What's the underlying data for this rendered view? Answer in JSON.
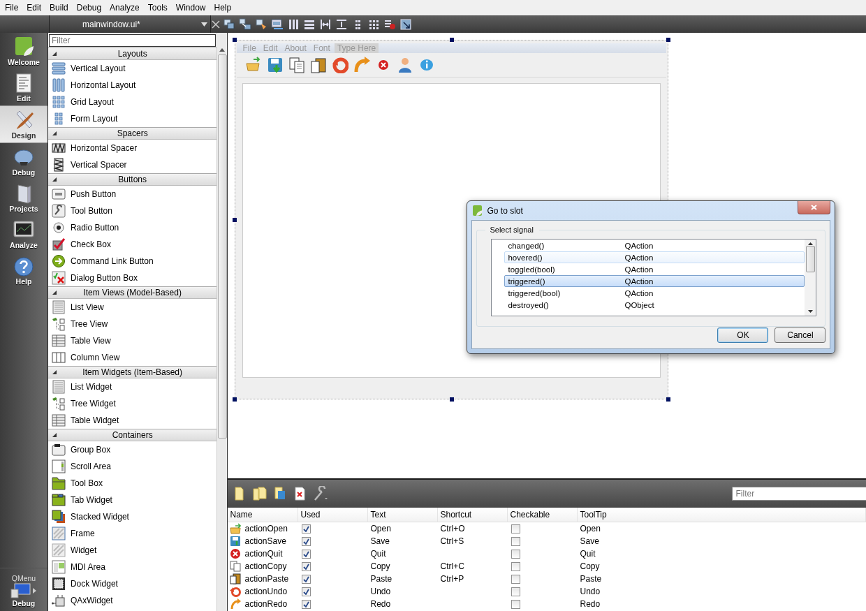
{
  "menubar": [
    "File",
    "Edit",
    "Build",
    "Debug",
    "Analyze",
    "Tools",
    "Window",
    "Help"
  ],
  "document": {
    "name": "mainwindow.ui*"
  },
  "mode_bar": {
    "items": [
      {
        "label": "Welcome",
        "selected": false
      },
      {
        "label": "Edit",
        "selected": false
      },
      {
        "label": "Design",
        "selected": true
      },
      {
        "label": "Debug",
        "selected": false
      },
      {
        "label": "Projects",
        "selected": false
      },
      {
        "label": "Analyze",
        "selected": false
      },
      {
        "label": "Help",
        "selected": false
      }
    ],
    "target_label": "QMenu",
    "target_mode": "Debug"
  },
  "widget_box": {
    "filter_placeholder": "Filter",
    "categories": [
      {
        "title": "Layouts",
        "items": [
          "Vertical Layout",
          "Horizontal Layout",
          "Grid Layout",
          "Form Layout"
        ]
      },
      {
        "title": "Spacers",
        "items": [
          "Horizontal Spacer",
          "Vertical Spacer"
        ]
      },
      {
        "title": "Buttons",
        "items": [
          "Push Button",
          "Tool Button",
          "Radio Button",
          "Check Box",
          "Command Link Button",
          "Dialog Button Box"
        ]
      },
      {
        "title": "Item Views (Model-Based)",
        "items": [
          "List View",
          "Tree View",
          "Table View",
          "Column View"
        ]
      },
      {
        "title": "Item Widgets (Item-Based)",
        "items": [
          "List Widget",
          "Tree Widget",
          "Table Widget"
        ]
      },
      {
        "title": "Containers",
        "items": [
          "Group Box",
          "Scroll Area",
          "Tool Box",
          "Tab Widget",
          "Stacked Widget",
          "Frame",
          "Widget",
          "MDI Area",
          "Dock Widget",
          "QAxWidget"
        ]
      }
    ]
  },
  "form": {
    "menu": [
      {
        "label": "File",
        "kind": "menu"
      },
      {
        "label": "Edit",
        "kind": "menu"
      },
      {
        "label": "About",
        "kind": "menu"
      },
      {
        "label": "Font",
        "kind": "menu"
      },
      {
        "label": "Type Here",
        "kind": "placeholder"
      }
    ]
  },
  "dialog": {
    "title": "Go to slot",
    "group_title": "Select signal",
    "signals": [
      {
        "name": "changed()",
        "class": "QAction",
        "hovered": false,
        "selected": false
      },
      {
        "name": "hovered()",
        "class": "QAction",
        "hovered": true,
        "selected": false
      },
      {
        "name": "toggled(bool)",
        "class": "QAction",
        "hovered": false,
        "selected": false
      },
      {
        "name": "triggered()",
        "class": "QAction",
        "hovered": false,
        "selected": true
      },
      {
        "name": "triggered(bool)",
        "class": "QAction",
        "hovered": false,
        "selected": false
      },
      {
        "name": "destroyed()",
        "class": "QObject",
        "hovered": false,
        "selected": false
      }
    ],
    "buttons": [
      "OK",
      "Cancel"
    ]
  },
  "action_editor": {
    "filter_placeholder": "Filter",
    "columns": [
      "Name",
      "Used",
      "Text",
      "Shortcut",
      "Checkable",
      "ToolTip"
    ],
    "actions": [
      {
        "name": "actionOpen",
        "used": true,
        "text": "Open",
        "shortcut": "Ctrl+O",
        "checkable": false,
        "tooltip": "Open"
      },
      {
        "name": "actionSave",
        "used": true,
        "text": "Save",
        "shortcut": "Ctrl+S",
        "checkable": false,
        "tooltip": "Save"
      },
      {
        "name": "actionQuit",
        "used": true,
        "text": "Quit",
        "checkable": false,
        "tooltip": "Quit"
      },
      {
        "name": "actionCopy",
        "used": true,
        "text": "Copy",
        "shortcut": "Ctrl+C",
        "checkable": false,
        "tooltip": "Copy"
      },
      {
        "name": "actionPaste",
        "used": true,
        "text": "Paste",
        "shortcut": "Ctrl+P",
        "checkable": false,
        "tooltip": "Paste"
      },
      {
        "name": "actionUndo",
        "used": true,
        "text": "Undo",
        "checkable": false,
        "tooltip": "Undo"
      },
      {
        "name": "actionRedo",
        "used": true,
        "text": "Redo",
        "checkable": false,
        "tooltip": "Redo"
      }
    ]
  }
}
